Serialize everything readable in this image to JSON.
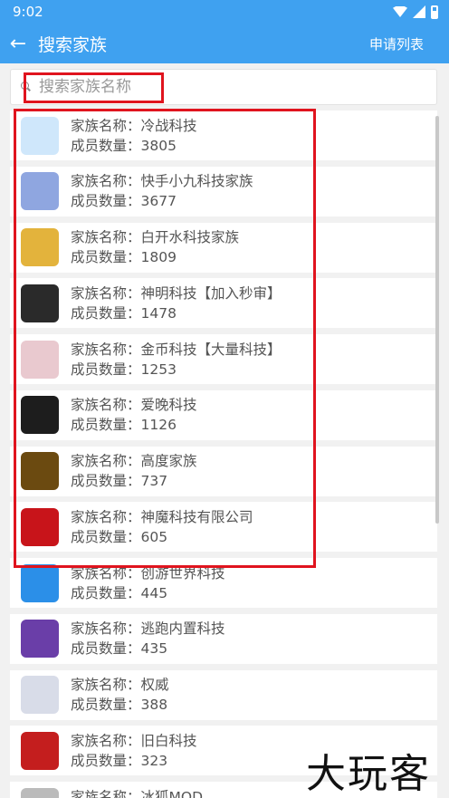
{
  "status": {
    "time": "9:02"
  },
  "appbar": {
    "title": "搜索家族",
    "action": "申请列表"
  },
  "search": {
    "placeholder": "搜索家族名称",
    "value": ""
  },
  "labels": {
    "name_prefix": "家族名称：",
    "count_prefix": "成员数量："
  },
  "families": [
    {
      "name": "冷战科技",
      "count": "3805",
      "avatar_color": "#cfe7fb"
    },
    {
      "name": "快手小九科技家族",
      "count": "3677",
      "avatar_color": "#8fa6e0"
    },
    {
      "name": "白开水科技家族",
      "count": "1809",
      "avatar_color": "#e3b33c"
    },
    {
      "name": "神明科技【加入秒审】",
      "count": "1478",
      "avatar_color": "#2a2a2a"
    },
    {
      "name": "金币科技【大量科技】",
      "count": "1253",
      "avatar_color": "#e9c9cf"
    },
    {
      "name": "爱晚科技",
      "count": "1126",
      "avatar_color": "#1d1d1d"
    },
    {
      "name": "高度家族",
      "count": "737",
      "avatar_color": "#6b4a10"
    },
    {
      "name": "神魔科技有限公司",
      "count": "605",
      "avatar_color": "#c8141a"
    },
    {
      "name": "创游世界科技",
      "count": "445",
      "avatar_color": "#2b8fe8"
    },
    {
      "name": "逃跑内置科技",
      "count": "435",
      "avatar_color": "#6a3ea8"
    },
    {
      "name": "权威",
      "count": "388",
      "avatar_color": "#d8dce8"
    },
    {
      "name": "旧白科技",
      "count": "323",
      "avatar_color": "#c41e1e"
    },
    {
      "name": "冰狐MOD",
      "count": "",
      "avatar_color": "#bbbbbb"
    }
  ],
  "watermark": "大玩客"
}
